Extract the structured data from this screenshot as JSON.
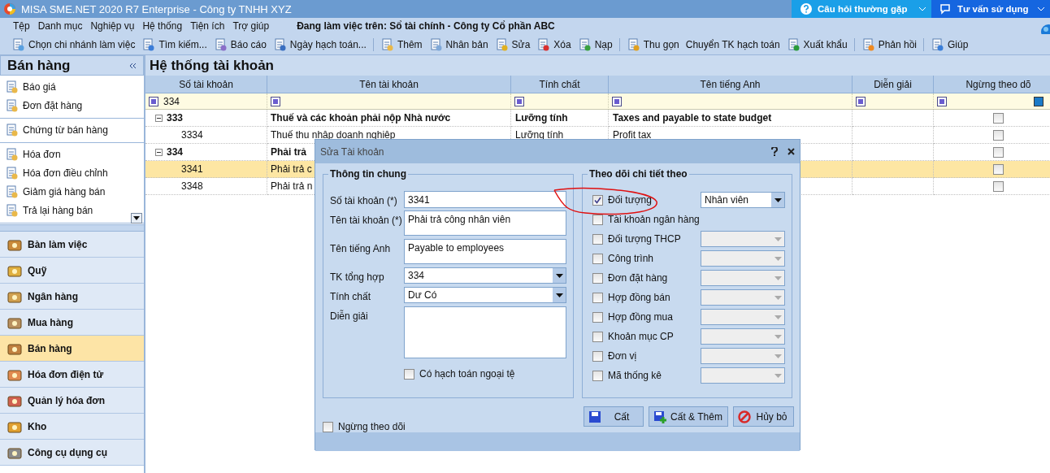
{
  "window": {
    "title": "MISA SME.NET 2020 R7 Enterprise - Công ty TNHH XYZ"
  },
  "help_buttons": [
    {
      "label": "Câu hỏi thường gặp"
    },
    {
      "label": "Tư vấn sử dụng"
    }
  ],
  "menu": {
    "items": [
      "Tệp",
      "Danh mục",
      "Nghiệp vụ",
      "Hệ thống",
      "Tiện ích",
      "Trợ giúp"
    ],
    "workspace": "Đang làm việc trên: Sổ tài chính - Công ty Cổ phần ABC"
  },
  "toolbar": [
    {
      "kind": "button",
      "label": "Chọn chi nhánh làm việc"
    },
    {
      "kind": "button",
      "label": "Tìm kiếm..."
    },
    {
      "kind": "button",
      "label": "Báo cáo"
    },
    {
      "kind": "button",
      "label": "Ngày hạch toán..."
    },
    {
      "kind": "separator"
    },
    {
      "kind": "button",
      "label": "Thêm"
    },
    {
      "kind": "button",
      "label": "Nhân bản"
    },
    {
      "kind": "button",
      "label": "Sửa"
    },
    {
      "kind": "button",
      "label": "Xóa"
    },
    {
      "kind": "button",
      "label": "Nạp"
    },
    {
      "kind": "separator"
    },
    {
      "kind": "button",
      "label": "Thu gọn"
    },
    {
      "kind": "text",
      "label": "Chuyển TK hạch toán"
    },
    {
      "kind": "button",
      "label": "Xuất khẩu"
    },
    {
      "kind": "separator"
    },
    {
      "kind": "button",
      "label": "Phản hồi"
    },
    {
      "kind": "separator"
    },
    {
      "kind": "button",
      "label": "Giúp"
    }
  ],
  "sidebar": {
    "title": "Bán hàng",
    "groups": [
      [
        "Báo giá",
        "Đơn đặt hàng"
      ],
      [
        "Chứng từ bán hàng"
      ],
      [
        "Hóa đơn",
        "Hóa đơn điều chỉnh",
        "Giảm giá hàng bán",
        "Trả lại hàng bán"
      ]
    ],
    "modules": [
      {
        "label": "Bàn làm việc",
        "selected": false
      },
      {
        "label": "Quỹ",
        "selected": false
      },
      {
        "label": "Ngân hàng",
        "selected": false
      },
      {
        "label": "Mua hàng",
        "selected": false
      },
      {
        "label": "Bán hàng",
        "selected": true
      },
      {
        "label": "Hóa đơn điện tử",
        "selected": false
      },
      {
        "label": "Quản lý hóa đơn",
        "selected": false
      },
      {
        "label": "Kho",
        "selected": false
      },
      {
        "label": "Công cụ dụng cụ",
        "selected": false
      }
    ]
  },
  "grid": {
    "title": "Hệ thống tài khoản",
    "columns": [
      "Số tài khoản",
      "Tên tài khoản",
      "Tính chất",
      "Tên tiếng Anh",
      "Diễn giải",
      "Ngừng theo dõ"
    ],
    "filter": {
      "account": "334"
    },
    "rows": [
      {
        "account": "333",
        "name": "Thuế và các khoản phải nộp Nhà nước",
        "nature": "Lưỡng tính",
        "english": "Taxes and payable to state budget",
        "expanded": true,
        "selected": false,
        "stopped": false,
        "children": [
          {
            "account": "3334",
            "name": "Thuế thu nhập doanh nghiệp",
            "nature": "Lưỡng tính",
            "english": "Profit tax",
            "selected": false,
            "stopped": false
          }
        ]
      },
      {
        "account": "334",
        "name": "Phải trả",
        "expanded": true,
        "selected": false,
        "stopped": false,
        "children": [
          {
            "account": "3341",
            "name": "Phải trả c",
            "selected": true,
            "stopped": false
          },
          {
            "account": "3348",
            "name": "Phải trả n",
            "selected": false,
            "stopped": false
          }
        ]
      }
    ]
  },
  "dialog": {
    "title": "Sửa Tài khoản",
    "general": {
      "title": "Thông tin chung",
      "fields": [
        {
          "kind": "text",
          "label": "Số tài khoản (*)",
          "value": "3341"
        },
        {
          "kind": "multiline",
          "label": "Tên tài khoản (*)",
          "value": "Phải trả công nhân viên"
        },
        {
          "kind": "multiline",
          "label": "Tên tiếng Anh",
          "value": "Payable to employees"
        },
        {
          "kind": "combo",
          "label": "TK tổng hợp",
          "value": "334"
        },
        {
          "kind": "combo",
          "label": "Tính chất",
          "value": "Dư Có"
        },
        {
          "kind": "memo",
          "label": "Diễn giải"
        }
      ],
      "foreign_currency": {
        "label": "Có hạch toán ngoại tệ",
        "checked": false
      }
    },
    "tracking": {
      "title": "Theo dõi chi tiết theo",
      "items": [
        {
          "kind": "combo",
          "label": "Đối tượng",
          "checked": true,
          "value": "Nhân viên"
        },
        {
          "kind": "plain",
          "label": "Tài khoản ngân hàng",
          "checked": false
        },
        {
          "kind": "combo",
          "label": "Đối tượng THCP",
          "checked": false
        },
        {
          "kind": "combo",
          "label": "Công trình",
          "checked": false
        },
        {
          "kind": "combo",
          "label": "Đơn đặt hàng",
          "checked": false
        },
        {
          "kind": "combo",
          "label": "Hợp đồng bán",
          "checked": false
        },
        {
          "kind": "combo",
          "label": "Hợp đồng mua",
          "checked": false
        },
        {
          "kind": "combo",
          "label": "Khoản mục CP",
          "checked": false
        },
        {
          "kind": "combo",
          "label": "Đơn vị",
          "checked": false
        },
        {
          "kind": "combo",
          "label": "Mã thống kê",
          "checked": false
        }
      ]
    },
    "stop_tracking": {
      "label": "Ngừng theo dõi",
      "checked": false
    },
    "buttons": [
      {
        "label": "Cất"
      },
      {
        "label": "Cất & Thêm"
      },
      {
        "label": "Hủy bỏ"
      }
    ]
  }
}
